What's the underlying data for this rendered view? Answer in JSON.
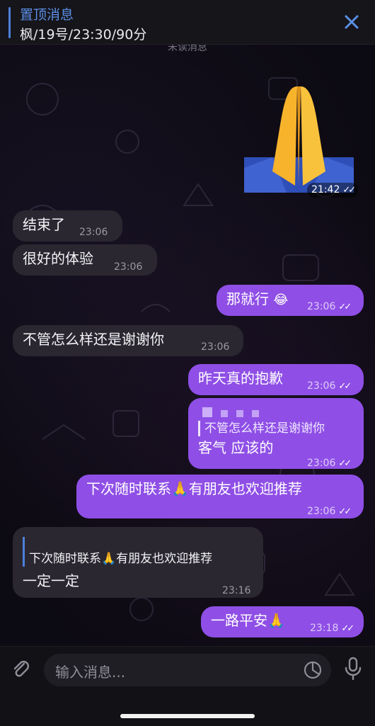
{
  "pinned": {
    "title": "置顶消息",
    "text": "枫/19号/23:30/90分"
  },
  "unread_divider": "未读消息",
  "composer": {
    "placeholder": "输入消息..."
  },
  "messages": [
    {
      "text": "🙏",
      "time": "21:42",
      "direction": "out",
      "sticker": "folded-hands-emoji"
    },
    {
      "text": "结束了",
      "time": "23:06",
      "direction": "in"
    },
    {
      "text": "很好的体验",
      "time": "23:06",
      "direction": "in"
    },
    {
      "text": "那就行",
      "emoji": "😂",
      "time": "23:06",
      "direction": "out"
    },
    {
      "text": "不管怎么样还是谢谢你",
      "time": "23:06",
      "direction": "in"
    },
    {
      "text": "昨天真的抱歉",
      "time": "23:06",
      "direction": "out"
    },
    {
      "quote": "不管怎么样还是谢谢你",
      "text": "客气 应该的",
      "time": "23:06",
      "direction": "out"
    },
    {
      "text": "下次随时联系🙏有朋友也欢迎推荐",
      "time": "23:06",
      "direction": "out"
    },
    {
      "quote": "下次随时联系🙏有朋友也欢迎推荐",
      "text": "一定一定",
      "time": "23:16",
      "direction": "in"
    },
    {
      "text": "一路平安🙏",
      "time": "23:18",
      "direction": "out"
    }
  ],
  "colors": {
    "outgoing_bubble": "#8f4fe6",
    "incoming_bubble": "#2a2730",
    "accent": "#5b8fe6"
  }
}
